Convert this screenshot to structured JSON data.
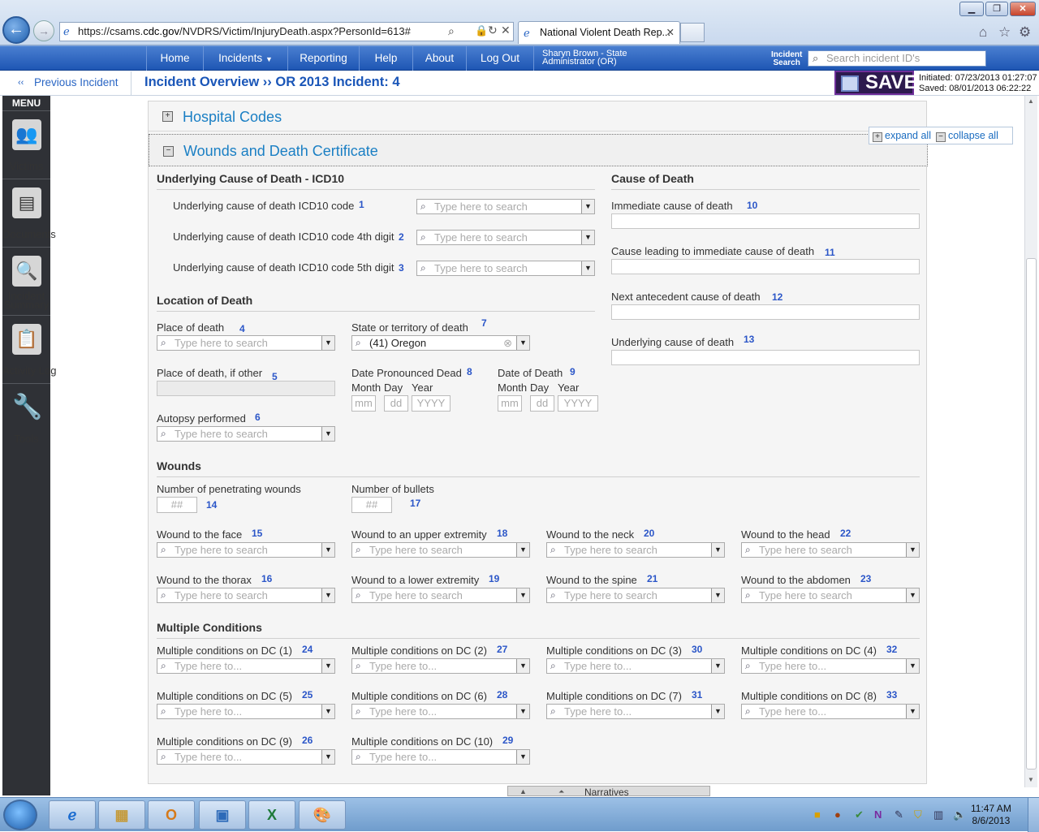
{
  "browser": {
    "url_prefix": "https://csams.",
    "url_domain": "cdc.gov",
    "url_rest": "/NVDRS/Victim/InjuryDeath.aspx?PersonId=613#",
    "tab_title": "National Violent Death Rep...",
    "min": "▁",
    "max": "❐",
    "close": "✕"
  },
  "nav": {
    "items": [
      "Home",
      "Incidents",
      "Reporting",
      "Help",
      "About",
      "Log Out"
    ],
    "user_line1": "Sharyn Brown - State",
    "user_line2": "Administrator (OR)",
    "search_label_1": "Incident",
    "search_label_2": "Search",
    "search_placeholder": "Search incident ID's"
  },
  "subheader": {
    "prev": "Previous Incident",
    "overview": "Incident Overview ›› OR 2013 Incident: 4",
    "save": "SAVE",
    "initiated": "Initiated: 07/23/2013 01:27:07",
    "saved": "Saved: 08/01/2013 06:22:22"
  },
  "menu": {
    "title": "MENU",
    "items": [
      "Victims",
      "Documents",
      "Incident Summary",
      "Activity Log",
      "Tools"
    ],
    "item_incident_1": "Incident",
    "item_incident_2": "Summary"
  },
  "panel": {
    "hospital_codes": "Hospital Codes",
    "wounds_title": "Wounds and Death Certificate",
    "expand_all": "expand all",
    "collapse_all": "collapse all"
  },
  "placeholder": "Type here to search",
  "placeholder_short": "Type here to...",
  "icd": {
    "title": "Underlying Cause of Death - ICD10",
    "f1": "Underlying cause of death ICD10 code",
    "n1": "1",
    "f2": "Underlying cause of death ICD10 code 4th digit",
    "n2": "2",
    "f3": "Underlying cause of death ICD10 code 5th digit",
    "n3": "3"
  },
  "cod": {
    "title": "Cause of Death",
    "f10": "Immediate cause of death",
    "n10": "10",
    "f11": "Cause leading to immediate cause of death",
    "n11": "11",
    "f12": "Next antecedent cause of death",
    "n12": "12",
    "f13": "Underlying cause of death",
    "n13": "13"
  },
  "loc": {
    "title": "Location of Death",
    "f4": "Place of death",
    "n4": "4",
    "f7": "State or territory of death",
    "n7": "7",
    "state_value": "(41) Oregon",
    "f5": "Place of death, if other",
    "n5": "5",
    "f8": "Date Pronounced Dead",
    "n8": "8",
    "f9": "Date of Death",
    "n9": "9",
    "month": "Month",
    "day": "Day",
    "year": "Year",
    "mm": "mm",
    "dd": "dd",
    "yyyy": "YYYY",
    "f6": "Autopsy performed",
    "n6": "6"
  },
  "wounds": {
    "title": "Wounds",
    "f14": "Number of penetrating wounds",
    "n14": "14",
    "f17": "Number of bullets",
    "n17": "17",
    "hash": "##",
    "fields": [
      {
        "label": "Wound to the face",
        "num": "15"
      },
      {
        "label": "Wound to an upper extremity",
        "num": "18"
      },
      {
        "label": "Wound to the neck",
        "num": "20"
      },
      {
        "label": "Wound to the head",
        "num": "22"
      },
      {
        "label": "Wound to the thorax",
        "num": "16"
      },
      {
        "label": "Wound to a lower extremity",
        "num": "19"
      },
      {
        "label": "Wound to the spine",
        "num": "21"
      },
      {
        "label": "Wound to the abdomen",
        "num": "23"
      }
    ]
  },
  "mc": {
    "title": "Multiple Conditions",
    "fields": [
      {
        "label": "Multiple conditions on DC (1)",
        "num": "24"
      },
      {
        "label": "Multiple conditions on DC (2)",
        "num": "27"
      },
      {
        "label": "Multiple conditions on DC (3)",
        "num": "30"
      },
      {
        "label": "Multiple conditions on DC (4)",
        "num": "32"
      },
      {
        "label": "Multiple conditions on DC (5)",
        "num": "25"
      },
      {
        "label": "Multiple conditions on DC (6)",
        "num": "28"
      },
      {
        "label": "Multiple conditions on DC (7)",
        "num": "31"
      },
      {
        "label": "Multiple conditions on DC (8)",
        "num": "33"
      },
      {
        "label": "Multiple conditions on DC (9)",
        "num": "26"
      },
      {
        "label": "Multiple conditions on DC (10)",
        "num": "29"
      }
    ]
  },
  "narratives": "Narratives",
  "taskbar": {
    "time": "11:47 AM",
    "date": "8/6/2013"
  }
}
